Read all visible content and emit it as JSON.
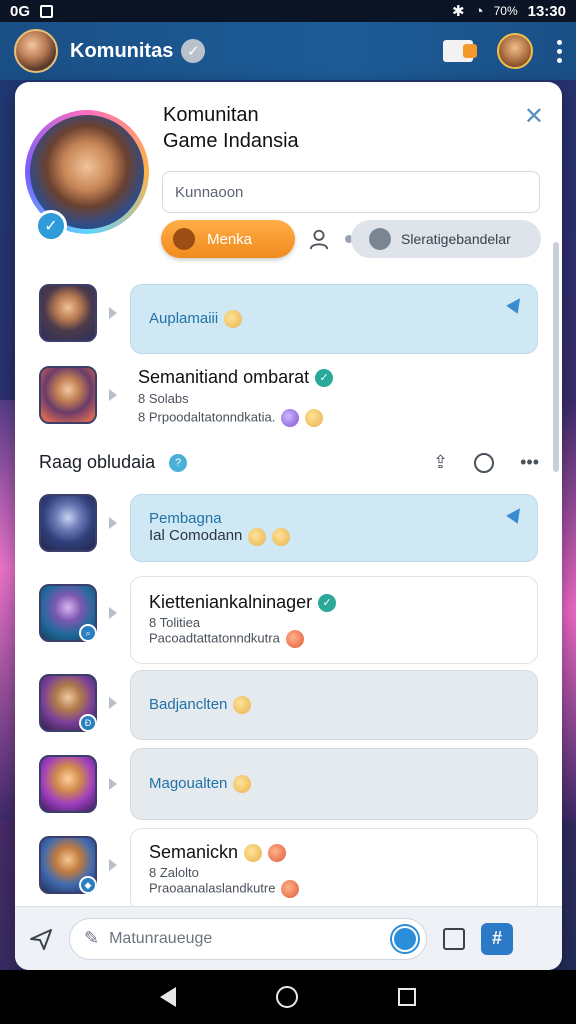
{
  "status_bar": {
    "left_text": "0G",
    "time": "13:30",
    "battery": "70%"
  },
  "app_bar": {
    "title": "Komunitas"
  },
  "group": {
    "title_line1": "Komunitan",
    "title_line2": "Game Indansia",
    "search_placeholder": "Kunnaoon",
    "primary_button": "Menka",
    "secondary_pill": "Sleratigebandelar"
  },
  "rows_top": [
    {
      "text": "Auplamaiii"
    },
    {
      "title": "Semanitiand ombarat",
      "sub1": "8 Solabs",
      "sub2": "8 Prpoodaltatonndkatia."
    }
  ],
  "section": {
    "title": "Raag obludaia"
  },
  "rows": [
    {
      "line1": "Pembagna",
      "line2": "Ial Comodann"
    },
    {
      "title": "Kietteniankalninager",
      "sub1": "8 Tolitiea",
      "sub2": "Pacoadtattatonndkutra"
    },
    {
      "text": "Badjanclten"
    },
    {
      "text": "Magoualten"
    },
    {
      "title": "Semanickn",
      "sub1": "8 Zalolto",
      "sub2": "Praoaanalaslandkutre"
    }
  ],
  "composer": {
    "placeholder": "Matunraueuge"
  },
  "colors": {
    "app_bar": "#1d5c97",
    "accent_orange": "#f39a2b",
    "bubble_blue": "#cfe8f3",
    "verified": "#2aa89a"
  }
}
